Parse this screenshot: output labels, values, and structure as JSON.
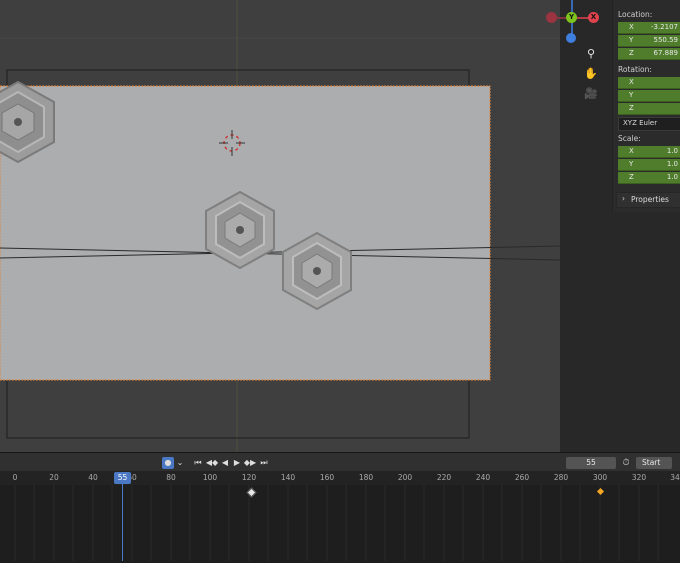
{
  "npanel": {
    "location_label": "Location:",
    "location": [
      {
        "axis": "X",
        "value": "-3.2107"
      },
      {
        "axis": "Y",
        "value": "550.59"
      },
      {
        "axis": "Z",
        "value": "67.889"
      }
    ],
    "rotation_label": "Rotation:",
    "rotation": [
      {
        "axis": "X",
        "value": ""
      },
      {
        "axis": "Y",
        "value": ""
      },
      {
        "axis": "Z",
        "value": ""
      }
    ],
    "rotation_mode": "XYZ Euler",
    "scale_label": "Scale:",
    "scale": [
      {
        "axis": "X",
        "value": "1.0"
      },
      {
        "axis": "Y",
        "value": "1.0"
      },
      {
        "axis": "Z",
        "value": "1.0"
      }
    ],
    "properties_label": "Properties"
  },
  "gizmo": {
    "y_label": "Y",
    "x_label": "X",
    "z_label": "Z"
  },
  "navtools": [
    "zoom-icon",
    "hand-icon",
    "camera-icon"
  ],
  "timeline": {
    "current_frame": "55",
    "start_label": "Start",
    "ruler_ticks": [
      "0",
      "20",
      "40",
      "60",
      "80",
      "100",
      "120",
      "140",
      "160",
      "180",
      "200",
      "220",
      "240",
      "260",
      "280",
      "300",
      "320",
      "34"
    ],
    "current_frame_badge": "55",
    "keyframe_frames": [
      120,
      300
    ]
  },
  "colors": {
    "accent_blue": "#4a78c4",
    "field_green": "#4f7d2c",
    "axis_x_red": "#e0424e",
    "axis_y_green": "#7ec21d",
    "axis_z_blue": "#3f7fe0",
    "keyframe_orange": "#f5a623"
  }
}
